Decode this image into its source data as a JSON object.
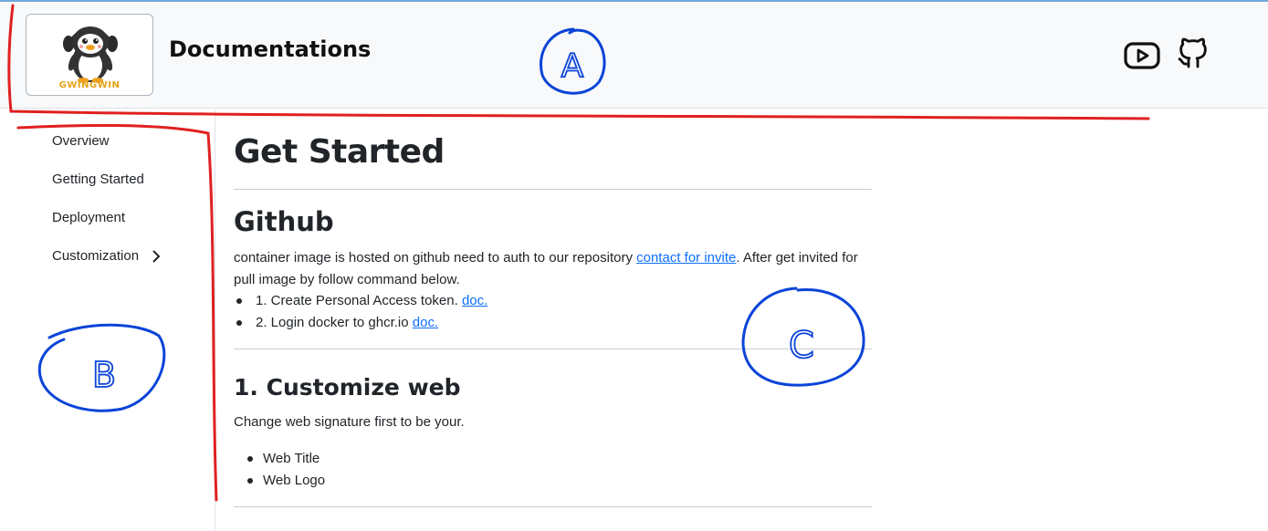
{
  "header": {
    "logo_text": "GWINGWIN",
    "title": "Documentations",
    "youtube_icon": "youtube-icon",
    "github_icon": "github-icon"
  },
  "sidebar": {
    "items": [
      {
        "label": "Overview"
      },
      {
        "label": "Getting Started"
      },
      {
        "label": "Deployment"
      },
      {
        "label": "Customization",
        "icon": "chevron-right-icon"
      }
    ]
  },
  "main": {
    "title": "Get Started",
    "github": {
      "heading": "Github",
      "text_before": "container image is hosted on github need to auth to our repository ",
      "invite_link": "contact for invite",
      "text_after": ". After get invited for pull image by follow command below.",
      "steps": [
        {
          "text": "1. Create Personal Access token. ",
          "link": "doc."
        },
        {
          "text": "2. Login docker to ghcr.io ",
          "link": "doc."
        }
      ]
    },
    "customize": {
      "heading": "1. Customize web",
      "text": "Change web signature first to be your.",
      "items": [
        "Web Title",
        "Web Logo"
      ]
    }
  },
  "annotations": {
    "labels": [
      "A",
      "B",
      "C"
    ],
    "colors": {
      "outline": "#e02020",
      "marker": "#0b44d8"
    }
  },
  "colors": {
    "link": "#0d6efd",
    "header_bg": "#f8f9fa"
  }
}
